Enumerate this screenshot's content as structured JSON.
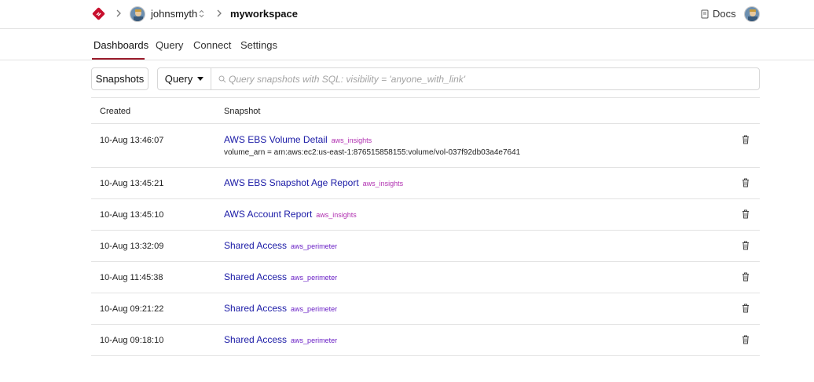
{
  "header": {
    "username": "johnsmyth",
    "workspace": "myworkspace",
    "docs_label": "Docs"
  },
  "tabs": [
    {
      "label": "Dashboards",
      "active": true
    },
    {
      "label": "Query",
      "active": false
    },
    {
      "label": "Connect",
      "active": false
    },
    {
      "label": "Settings",
      "active": false
    }
  ],
  "toolbar": {
    "snapshots_label": "Snapshots",
    "query_label": "Query",
    "search_placeholder": "Query snapshots with SQL: visibility = 'anyone_with_link'"
  },
  "table": {
    "columns": [
      "Created",
      "Snapshot"
    ],
    "rows": [
      {
        "created": "10-Aug 13:46:07",
        "title": "AWS EBS Volume Detail",
        "tag": "aws_insights",
        "tag_color": "#b02fb0",
        "detail": "volume_arn = arn:aws:ec2:us-east-1:876515858155:volume/vol-037f92db03a4e7641"
      },
      {
        "created": "10-Aug 13:45:21",
        "title": "AWS EBS Snapshot Age Report",
        "tag": "aws_insights",
        "tag_color": "#b02fb0",
        "detail": ""
      },
      {
        "created": "10-Aug 13:45:10",
        "title": "AWS Account Report",
        "tag": "aws_insights",
        "tag_color": "#b02fb0",
        "detail": ""
      },
      {
        "created": "10-Aug 13:32:09",
        "title": "Shared Access",
        "tag": "aws_perimeter",
        "tag_color": "#6b22c6",
        "detail": ""
      },
      {
        "created": "10-Aug 11:45:38",
        "title": "Shared Access",
        "tag": "aws_perimeter",
        "tag_color": "#6b22c6",
        "detail": ""
      },
      {
        "created": "10-Aug 09:21:22",
        "title": "Shared Access",
        "tag": "aws_perimeter",
        "tag_color": "#6b22c6",
        "detail": ""
      },
      {
        "created": "10-Aug 09:18:10",
        "title": "Shared Access",
        "tag": "aws_perimeter",
        "tag_color": "#6b22c6",
        "detail": ""
      }
    ]
  },
  "colors": {
    "accent": "#9b1c2c",
    "link": "#1a1aa6"
  }
}
